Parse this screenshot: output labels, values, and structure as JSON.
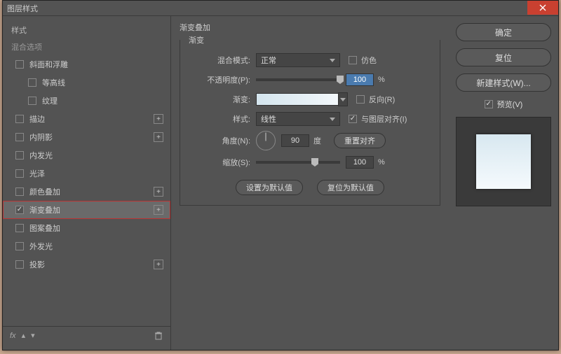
{
  "window": {
    "title": "图层样式"
  },
  "sidebar": {
    "heading": "样式",
    "sub": "混合选项",
    "items": [
      {
        "label": "斜面和浮雕",
        "checked": false,
        "plus": false,
        "indent": false
      },
      {
        "label": "等高线",
        "checked": false,
        "plus": false,
        "indent": true
      },
      {
        "label": "纹理",
        "checked": false,
        "plus": false,
        "indent": true
      },
      {
        "label": "描边",
        "checked": false,
        "plus": true,
        "indent": false
      },
      {
        "label": "内阴影",
        "checked": false,
        "plus": true,
        "indent": false
      },
      {
        "label": "内发光",
        "checked": false,
        "plus": false,
        "indent": false
      },
      {
        "label": "光泽",
        "checked": false,
        "plus": false,
        "indent": false
      },
      {
        "label": "颜色叠加",
        "checked": false,
        "plus": true,
        "indent": false
      },
      {
        "label": "渐变叠加",
        "checked": true,
        "plus": true,
        "indent": false,
        "selected": true,
        "highlight": true
      },
      {
        "label": "图案叠加",
        "checked": false,
        "plus": false,
        "indent": false
      },
      {
        "label": "外发光",
        "checked": false,
        "plus": false,
        "indent": false
      },
      {
        "label": "投影",
        "checked": false,
        "plus": true,
        "indent": false
      }
    ],
    "footer_fx": "fx"
  },
  "main": {
    "title": "渐变叠加",
    "group_title": "渐变",
    "blend_label": "混合模式:",
    "blend_value": "正常",
    "dither_label": "仿色",
    "dither_checked": false,
    "opacity_label": "不透明度(P):",
    "opacity_value": "100",
    "opacity_unit": "%",
    "gradient_label": "渐变:",
    "reverse_label": "反向(R)",
    "reverse_checked": false,
    "style_label": "样式:",
    "style_value": "线性",
    "align_label": "与图层对齐(I)",
    "align_checked": true,
    "angle_label": "角度(N):",
    "angle_value": "90",
    "angle_unit": "度",
    "reset_align": "重置对齐",
    "scale_label": "缩放(S):",
    "scale_value": "100",
    "scale_unit": "%",
    "set_default": "设置为默认值",
    "reset_default": "复位为默认值"
  },
  "right": {
    "ok": "确定",
    "cancel": "复位",
    "new_style": "新建样式(W)...",
    "preview_label": "预览(V)",
    "preview_checked": true
  }
}
